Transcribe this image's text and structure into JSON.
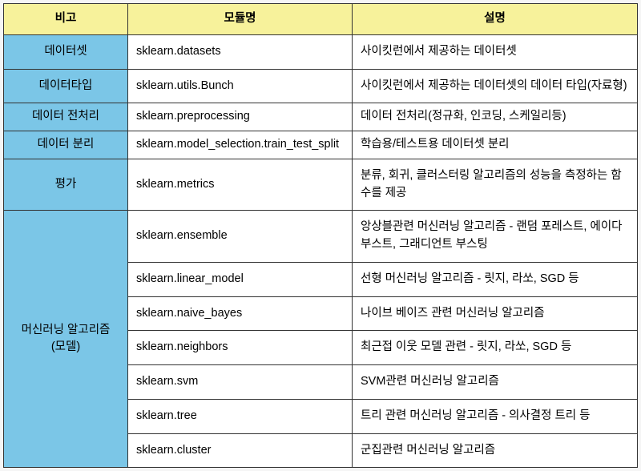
{
  "chart_data": {
    "type": "table",
    "headers": {
      "remark": "비고",
      "module": "모듈명",
      "desc": "설명"
    },
    "rows": [
      {
        "remark": "데이터셋",
        "module": "sklearn.datasets",
        "desc": "사이킷런에서 제공하는 데이터셋"
      },
      {
        "remark": "데이터타입",
        "module": "sklearn.utils.Bunch",
        "desc": "사이킷런에서 제공하는 데이터셋의 데이터 타입(자료형)"
      },
      {
        "remark": "데이터 전처리",
        "module": "sklearn.preprocessing",
        "desc": "데이터 전처리(정규화, 인코딩, 스케일리등)"
      },
      {
        "remark": "데이터 분리",
        "module": "sklearn.model_selection.train_test_split",
        "desc": "학습용/테스트용 데이터셋 분리"
      },
      {
        "remark": "평가",
        "module": "sklearn.metrics",
        "desc": "분류, 회귀, 클러스터링 알고리즘의 성능을 측정하는 함수를 제공"
      },
      {
        "remark": "머신러닝 알고리즘\n(모델)",
        "module": "sklearn.ensemble",
        "desc": "앙상블관련 머신러닝 알고리즘  - 랜덤 포레스트, 에이다 부스트, 그래디언트 부스팅"
      },
      {
        "remark": "",
        "module": "sklearn.linear_model",
        "desc": "선형 머신러닝 알고리즘 - 릿지, 라쏘, SGD 등"
      },
      {
        "remark": "",
        "module": "sklearn.naive_bayes",
        "desc": "나이브 베이즈 관련 머신러닝 알고리즘"
      },
      {
        "remark": "",
        "module": "sklearn.neighbors",
        "desc": "최근접 이웃 모델 관련 - 릿지, 라쏘, SGD 등"
      },
      {
        "remark": "",
        "module": "sklearn.svm",
        "desc": "SVM관련 머신러닝 알고리즘"
      },
      {
        "remark": "",
        "module": "sklearn.tree",
        "desc": "트리 관련 머신러닝 알고리즘 - 의사결정 트리 등"
      },
      {
        "remark": "",
        "module": "sklearn.cluster",
        "desc": "군집관련 머신러닝 알고리즘"
      }
    ]
  }
}
